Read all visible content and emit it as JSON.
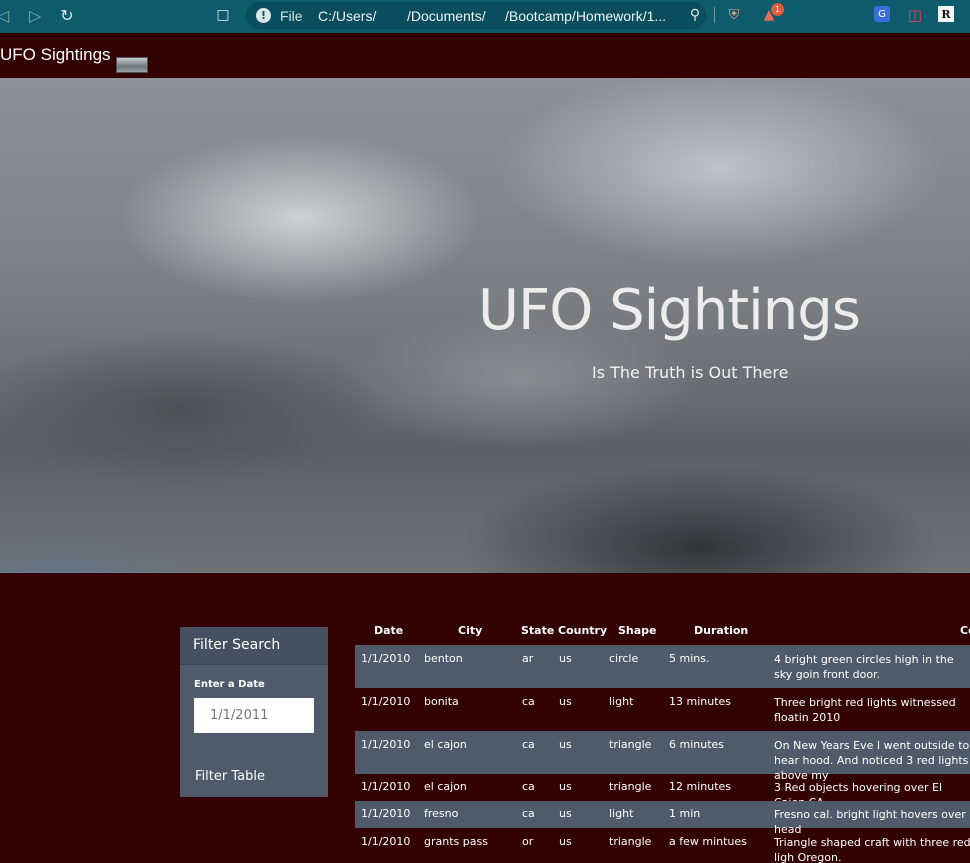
{
  "browser": {
    "file_label": "File",
    "address_parts": [
      "C:/Users/",
      "/Documents/",
      "/Bootcamp/Homework/1..."
    ],
    "brave_badge_count": "1"
  },
  "navbar": {
    "brand": "UFO Sightings"
  },
  "hero": {
    "title": "UFO Sightings",
    "subtitle": "Is The Truth is Out There"
  },
  "filter": {
    "heading": "Filter Search",
    "date_label": "Enter a Date",
    "date_placeholder": "1/1/2011",
    "button_label": "Filter Table"
  },
  "table": {
    "headers": [
      "Date",
      "City",
      "State",
      "Country",
      "Shape",
      "Duration",
      "Co"
    ],
    "rows": [
      {
        "date": "1/1/2010",
        "city": "benton",
        "state": "ar",
        "country": "us",
        "shape": "circle",
        "duration": "5 mins.",
        "comment": "4 bright green circles high in the sky goin front door."
      },
      {
        "date": "1/1/2010",
        "city": "bonita",
        "state": "ca",
        "country": "us",
        "shape": "light",
        "duration": "13 minutes",
        "comment": "Three bright red lights witnessed floatin 2010"
      },
      {
        "date": "1/1/2010",
        "city": "el cajon",
        "state": "ca",
        "country": "us",
        "shape": "triangle",
        "duration": "6 minutes",
        "comment": "On New Years Eve I went outside to hear hood. And noticed 3 red lights above my"
      },
      {
        "date": "1/1/2010",
        "city": "el cajon",
        "state": "ca",
        "country": "us",
        "shape": "triangle",
        "duration": "12 minutes",
        "comment": "3 Red objects hovering over El Cajon CA"
      },
      {
        "date": "1/1/2010",
        "city": "fresno",
        "state": "ca",
        "country": "us",
        "shape": "light",
        "duration": "1 min",
        "comment": "Fresno cal. bright light hovers over head"
      },
      {
        "date": "1/1/2010",
        "city": "grants pass",
        "state": "or",
        "country": "us",
        "shape": "triangle",
        "duration": "a few mintues",
        "comment": "Triangle shaped craft with three red ligh Oregon."
      }
    ]
  },
  "colors": {
    "page_bg": "#330303",
    "toolbar_bg": "#0e5b6b",
    "row_alt_bg": "#4f5b6b",
    "panel_bg": "#4f5b6b"
  }
}
